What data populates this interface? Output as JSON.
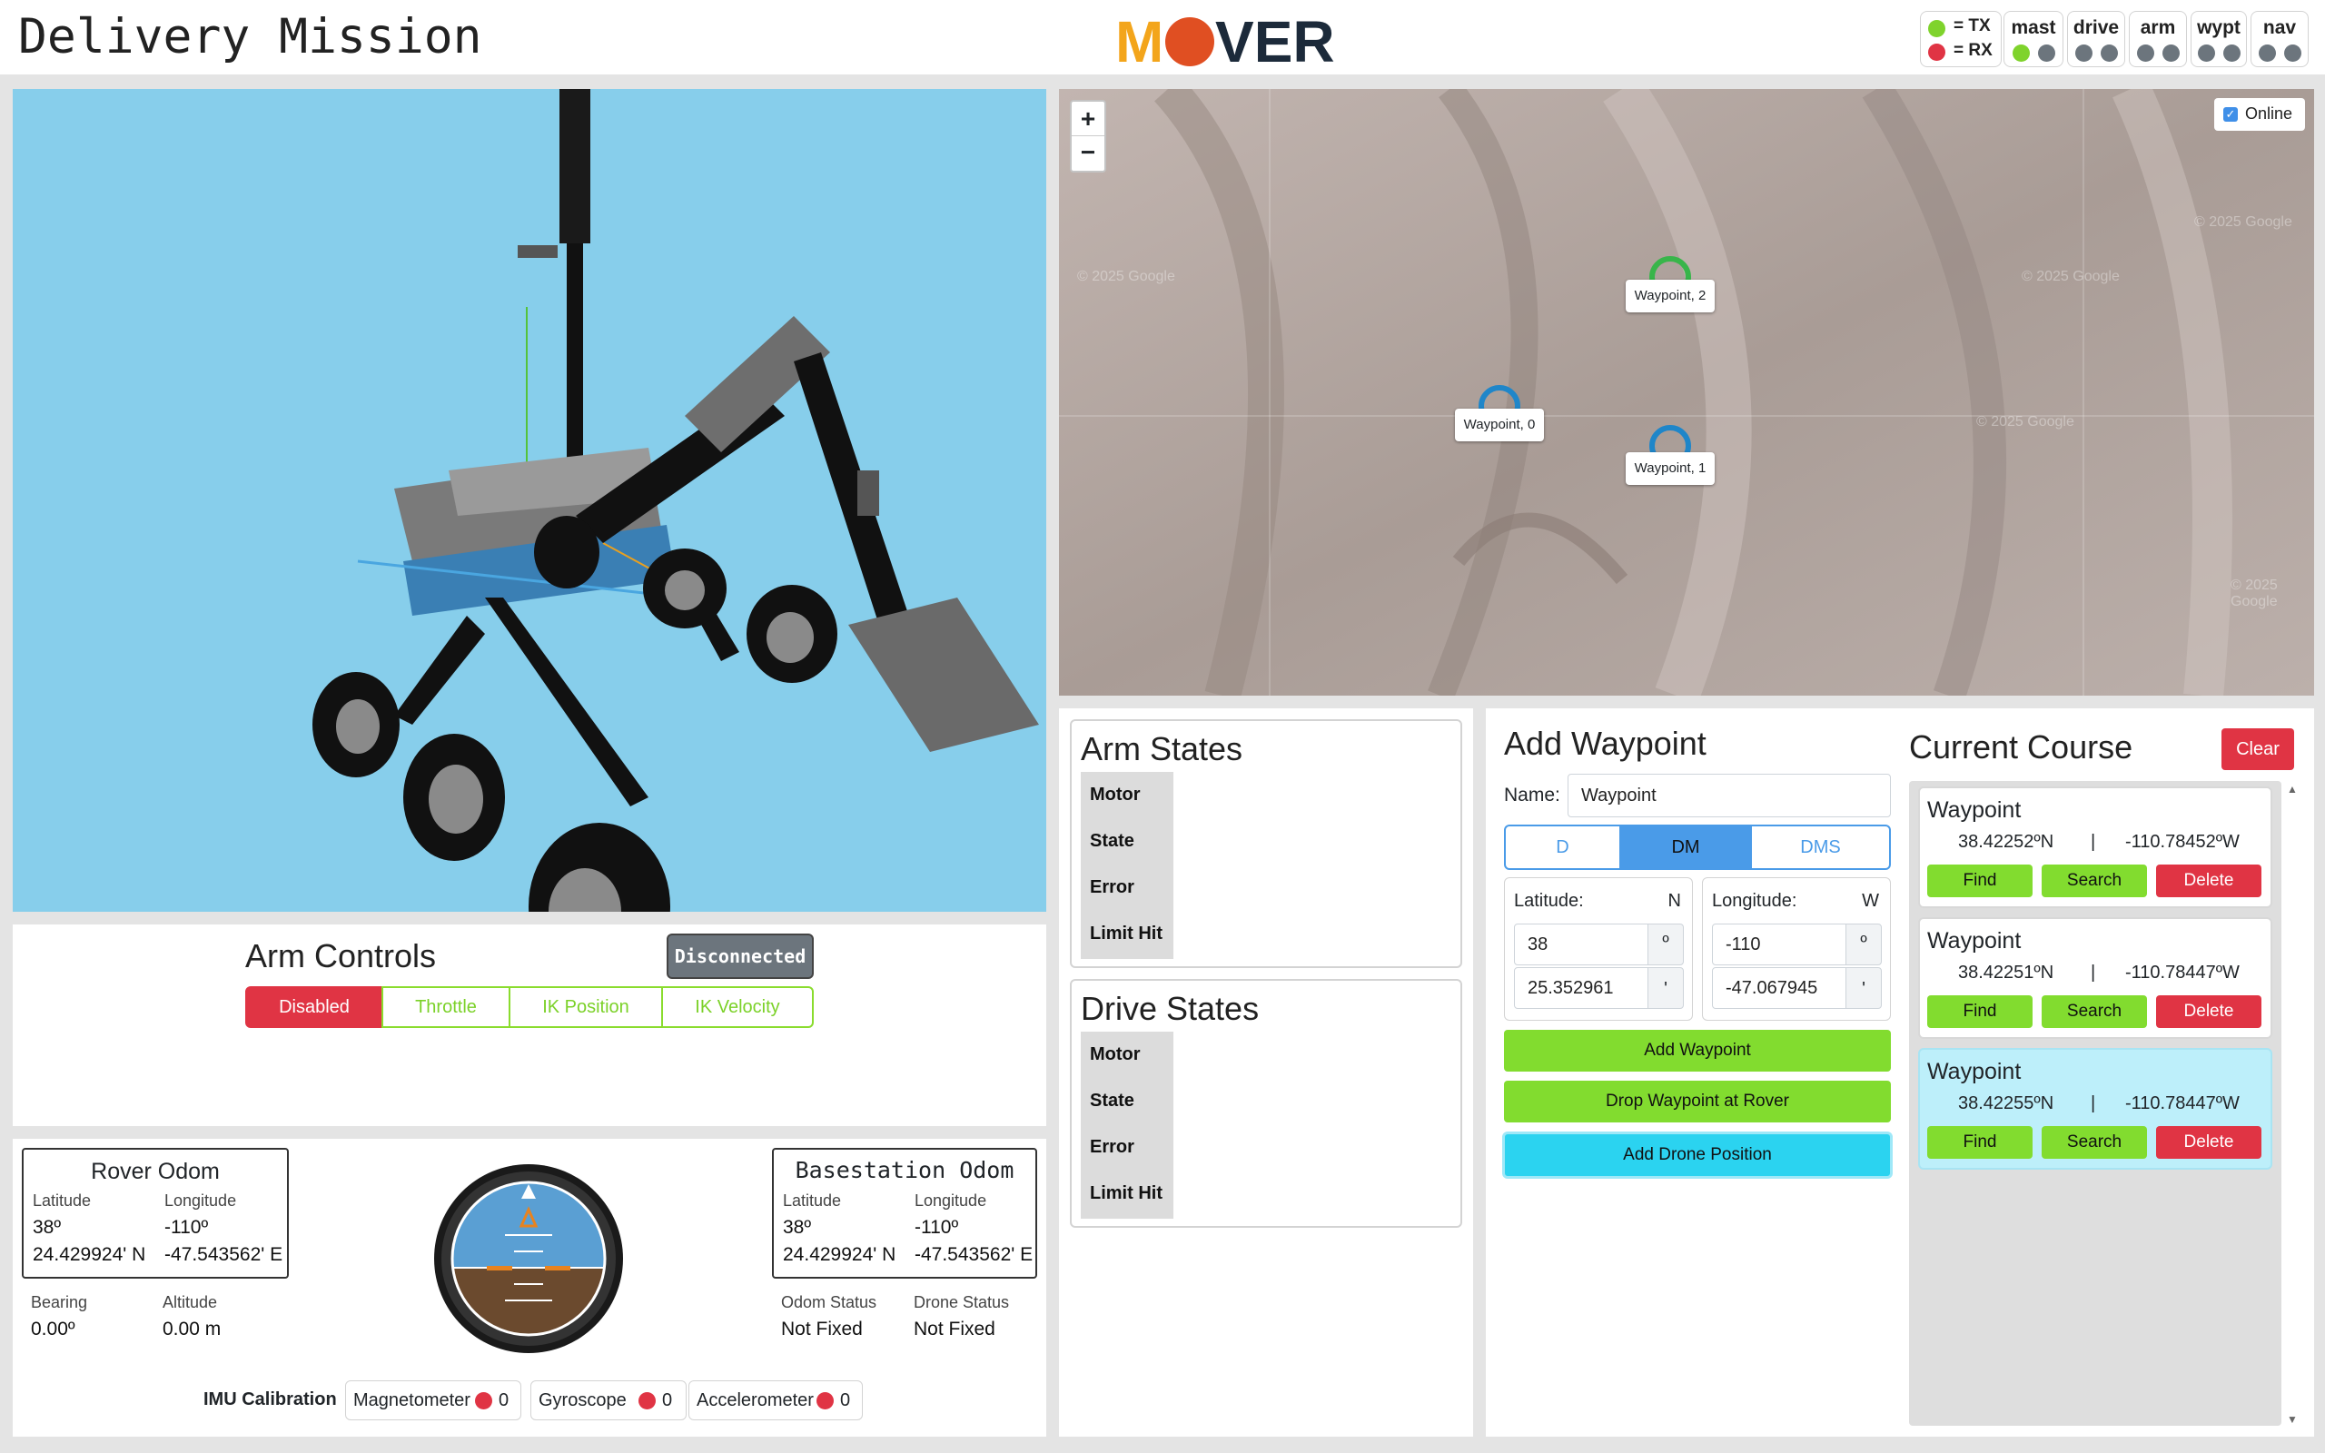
{
  "header": {
    "title": "Delivery Mission",
    "logo_text": "MROVER",
    "legend": {
      "tx": "= TX",
      "rx": "= RX",
      "tx_color": "#7fd32c",
      "rx_color": "#e03444"
    },
    "status_pills": [
      {
        "label": "mast",
        "tx": "#7fd32c",
        "rx": "#6c757d"
      },
      {
        "label": "drive",
        "tx": "#6c757d",
        "rx": "#6c757d"
      },
      {
        "label": "arm",
        "tx": "#6c757d",
        "rx": "#6c757d"
      },
      {
        "label": "wypt",
        "tx": "#6c757d",
        "rx": "#6c757d"
      },
      {
        "label": "nav",
        "tx": "#6c757d",
        "rx": "#6c757d"
      }
    ]
  },
  "map": {
    "zoom_in": "+",
    "zoom_out": "−",
    "online_label": "Online",
    "online_checked": true,
    "watermark": "© 2025 Google",
    "markers": [
      "Waypoint, 2",
      "Waypoint, 0",
      "Waypoint, 1"
    ]
  },
  "arm_controls": {
    "title": "Arm Controls",
    "connection": "Disconnected",
    "modes": [
      "Disabled",
      "Throttle",
      "IK Position",
      "IK Velocity"
    ],
    "active_mode": "Disabled"
  },
  "rover_odom": {
    "title": "Rover Odom",
    "lat_label": "Latitude",
    "lon_label": "Longitude",
    "lat_deg": "38º",
    "lon_deg": "-110º",
    "lat_min": "24.429924' N",
    "lon_min": "-47.543562' E",
    "bearing_label": "Bearing",
    "bearing": "0.00º",
    "altitude_label": "Altitude",
    "altitude": "0.00 m"
  },
  "basestation_odom": {
    "title": "Basestation Odom",
    "lat_label": "Latitude",
    "lon_label": "Longitude",
    "lat_deg": "38º",
    "lon_deg": "-110º",
    "lat_min": "24.429924' N",
    "lon_min": "-47.543562' E",
    "odom_status_label": "Odom Status",
    "odom_status": "Not Fixed",
    "drone_status_label": "Drone Status",
    "drone_status": "Not Fixed"
  },
  "imu": {
    "label": "IMU Calibration",
    "items": [
      {
        "name": "Magnetometer",
        "value": "0"
      },
      {
        "name": "Gyroscope",
        "value": "0"
      },
      {
        "name": "Accelerometer",
        "value": "0"
      }
    ]
  },
  "arm_states": {
    "title": "Arm States",
    "rows": [
      "Motor",
      "State",
      "Error",
      "Limit Hit"
    ]
  },
  "drive_states": {
    "title": "Drive States",
    "rows": [
      "Motor",
      "State",
      "Error",
      "Limit Hit"
    ]
  },
  "add_waypoint": {
    "title": "Add Waypoint",
    "name_label": "Name:",
    "name_value": "Waypoint",
    "formats": [
      "D",
      "DM",
      "DMS"
    ],
    "active_format": "DM",
    "lat_label": "Latitude:",
    "lat_hemi": "N",
    "lon_label": "Longitude:",
    "lon_hemi": "W",
    "lat_deg": "38",
    "lat_min": "25.352961",
    "lon_deg": "-110",
    "lon_min": "-47.067945",
    "deg_sym": "º",
    "min_sym": "'",
    "add_btn": "Add Waypoint",
    "drop_btn": "Drop Waypoint at Rover",
    "drone_btn": "Add Drone Position"
  },
  "course": {
    "title": "Current Course",
    "clear": "Clear",
    "sep": "|",
    "find": "Find",
    "search": "Search",
    "delete": "Delete",
    "waypoints": [
      {
        "name": "Waypoint",
        "lat": "38.42252ºN",
        "lon": "-110.78452ºW"
      },
      {
        "name": "Waypoint",
        "lat": "38.42251ºN",
        "lon": "-110.78447ºW"
      },
      {
        "name": "Waypoint",
        "lat": "38.42255ºN",
        "lon": "-110.78447ºW"
      }
    ]
  }
}
